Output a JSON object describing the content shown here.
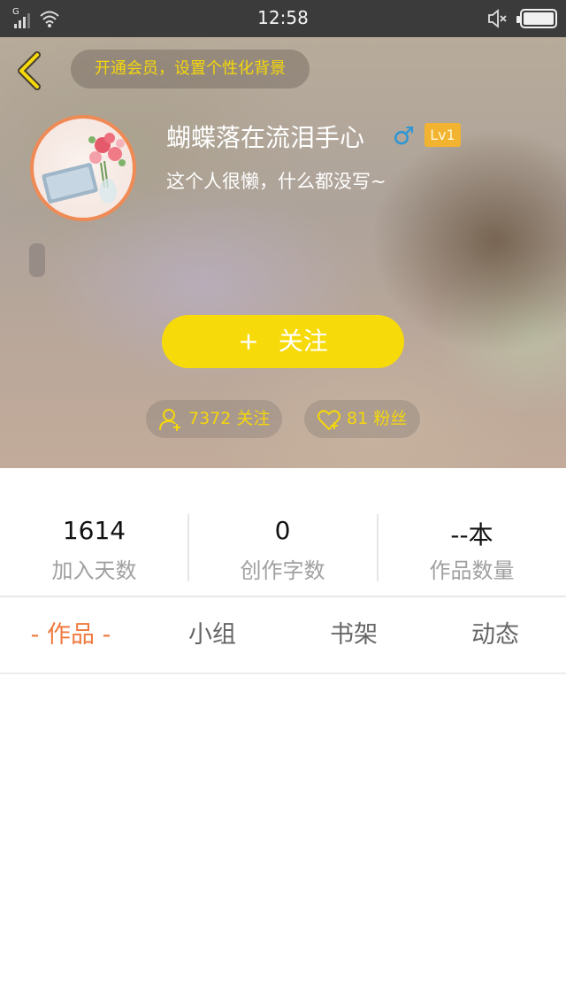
{
  "status_bar": {
    "network": "G",
    "time": "12:58"
  },
  "header": {
    "vip_prompt": "开通会员，设置个性化背景",
    "username": "蝴蝶落在流泪手心",
    "gender_symbol": "♂",
    "level": "Lv1",
    "signature": "这个人很懒，什么都没写~",
    "follow_button": {
      "plus": "+",
      "label": "关注"
    },
    "following": "7372 关注",
    "fans": "81 粉丝"
  },
  "stats": [
    {
      "value": "1614",
      "label": "加入天数"
    },
    {
      "value": "0",
      "label": "创作字数"
    },
    {
      "value": "--本",
      "label": "作品数量"
    }
  ],
  "tabs": [
    {
      "label": "- 作品 -",
      "active": true
    },
    {
      "label": "小组",
      "active": false
    },
    {
      "label": "书架",
      "active": false
    },
    {
      "label": "动态",
      "active": false
    }
  ],
  "colors": {
    "accent_yellow": "#f7da0a",
    "accent_orange": "#f07a3e",
    "gender_blue": "#2a96d6",
    "level_badge": "#f2b430"
  },
  "icons": [
    "back-arrow-icon",
    "user-add-icon",
    "heart-icon",
    "mute-icon",
    "battery-icon",
    "wifi-icon",
    "signal-icon"
  ]
}
